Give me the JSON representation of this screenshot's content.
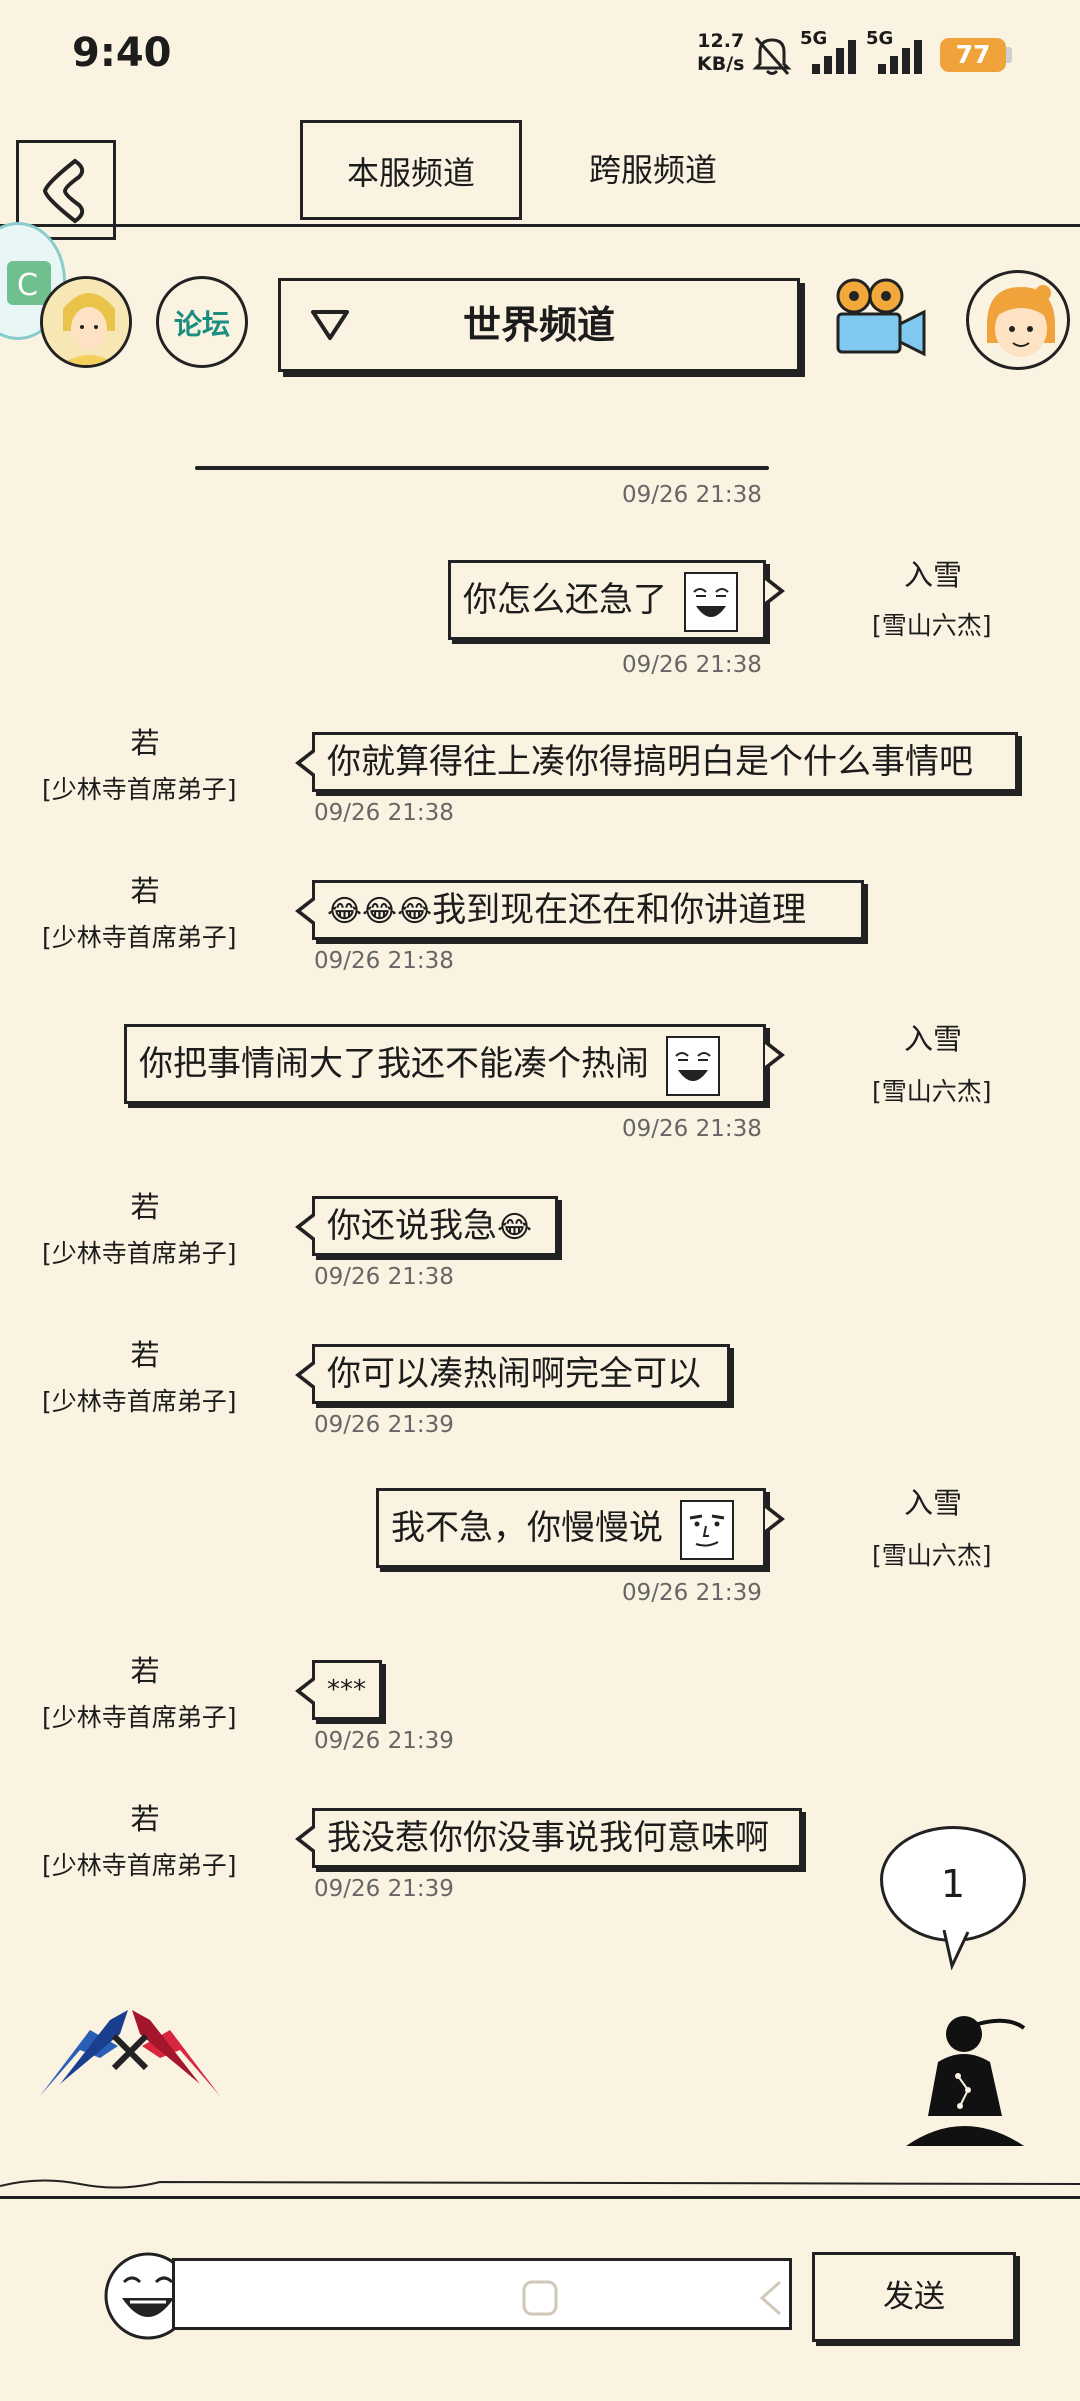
{
  "status_bar": {
    "time": "9:40",
    "net_speed_value": "12.7",
    "net_speed_unit": "KB/s",
    "network_1": "5G",
    "network_2": "5G",
    "battery": "77",
    "icons": [
      "mute-bell-icon",
      "signal-bars-icon",
      "signal-bars-icon"
    ]
  },
  "tabs": [
    {
      "label": "本服频道",
      "active": true
    },
    {
      "label": "跨服频道",
      "active": false
    }
  ],
  "forum_badge": "论坛",
  "channel": {
    "label": "世界频道",
    "icon": "triangle-down-icon"
  },
  "messages": [
    {
      "side": "right",
      "name": "入雪",
      "title": "[雪山六杰]",
      "text": "你怎么还急了",
      "time": "09/26 21:38",
      "face": "smirk-face-icon"
    },
    {
      "side": "left",
      "name": "若",
      "title": "[少林寺首席弟子]",
      "text": "你就算得往上凑你得搞明白是个什么事情吧",
      "time": "09/26 21:38"
    },
    {
      "side": "left",
      "name": "若",
      "title": "[少林寺首席弟子]",
      "emoji": "😂😂😂",
      "text": "我到现在还在和你讲道理",
      "time": "09/26 21:38"
    },
    {
      "side": "right",
      "name": "入雪",
      "title": "[雪山六杰]",
      "text": "你把事情闹大了我还不能凑个热闹",
      "time": "09/26 21:38",
      "face": "smirk-face-icon"
    },
    {
      "side": "left",
      "name": "若",
      "title": "[少林寺首席弟子]",
      "text": "你还说我急",
      "emoji": "😂",
      "time": "09/26 21:38"
    },
    {
      "side": "left",
      "name": "若",
      "title": "[少林寺首席弟子]",
      "text": "你可以凑热闹啊完全可以",
      "time": "09/26 21:39"
    },
    {
      "side": "right",
      "name": "入雪",
      "title": "[雪山六杰]",
      "text": "我不急，你慢慢说",
      "time": "09/26 21:39",
      "face": "smug-face-icon"
    },
    {
      "side": "left",
      "name": "若",
      "title": "[少林寺首席弟子]",
      "text": "***",
      "time": "09/26 21:39"
    },
    {
      "side": "left",
      "name": "若",
      "title": "[少林寺首席弟子]",
      "text": "我没惹你你没事说我何意味啊",
      "time": "09/26 21:39"
    }
  ],
  "top_time": "09/26 21:38",
  "unread_count": "1",
  "input": {
    "placeholder": "",
    "value": ""
  },
  "send_label": "发送"
}
